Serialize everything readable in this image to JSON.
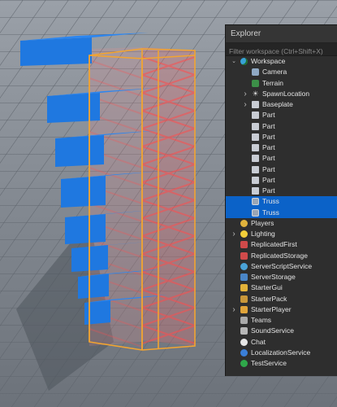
{
  "explorer": {
    "title": "Explorer",
    "filter_placeholder": "Filter workspace (Ctrl+Shift+X)",
    "items": [
      {
        "label": "Workspace",
        "icon": "workspace-icon",
        "depth": 0,
        "chevron": "expanded",
        "selected": false
      },
      {
        "label": "Camera",
        "icon": "camera-icon",
        "depth": 1,
        "chevron": "",
        "selected": false
      },
      {
        "label": "Terrain",
        "icon": "terrain-icon",
        "depth": 1,
        "chevron": "",
        "selected": false
      },
      {
        "label": "SpawnLocation",
        "icon": "spawn-icon",
        "depth": 1,
        "chevron": "collapsed",
        "selected": false
      },
      {
        "label": "Baseplate",
        "icon": "part-icon",
        "depth": 1,
        "chevron": "collapsed",
        "selected": false
      },
      {
        "label": "Part",
        "icon": "part-icon",
        "depth": 1,
        "chevron": "",
        "selected": false
      },
      {
        "label": "Part",
        "icon": "part-icon",
        "depth": 1,
        "chevron": "",
        "selected": false
      },
      {
        "label": "Part",
        "icon": "part-icon",
        "depth": 1,
        "chevron": "",
        "selected": false
      },
      {
        "label": "Part",
        "icon": "part-icon",
        "depth": 1,
        "chevron": "",
        "selected": false
      },
      {
        "label": "Part",
        "icon": "part-icon",
        "depth": 1,
        "chevron": "",
        "selected": false
      },
      {
        "label": "Part",
        "icon": "part-icon",
        "depth": 1,
        "chevron": "",
        "selected": false
      },
      {
        "label": "Part",
        "icon": "part-icon",
        "depth": 1,
        "chevron": "",
        "selected": false
      },
      {
        "label": "Part",
        "icon": "part-icon",
        "depth": 1,
        "chevron": "",
        "selected": false
      },
      {
        "label": "Truss",
        "icon": "truss-icon",
        "depth": 1,
        "chevron": "",
        "selected": true
      },
      {
        "label": "Truss",
        "icon": "truss-icon",
        "depth": 1,
        "chevron": "",
        "selected": true
      },
      {
        "label": "Players",
        "icon": "players-icon",
        "depth": 0,
        "chevron": "",
        "selected": false
      },
      {
        "label": "Lighting",
        "icon": "lighting-icon",
        "depth": 0,
        "chevron": "collapsed",
        "selected": false
      },
      {
        "label": "ReplicatedFirst",
        "icon": "replicated-first-icon",
        "depth": 0,
        "chevron": "",
        "selected": false
      },
      {
        "label": "ReplicatedStorage",
        "icon": "replicated-storage-icon",
        "depth": 0,
        "chevron": "",
        "selected": false
      },
      {
        "label": "ServerScriptService",
        "icon": "server-script-service-icon",
        "depth": 0,
        "chevron": "",
        "selected": false
      },
      {
        "label": "ServerStorage",
        "icon": "server-storage-icon",
        "depth": 0,
        "chevron": "",
        "selected": false
      },
      {
        "label": "StarterGui",
        "icon": "starter-gui-icon",
        "depth": 0,
        "chevron": "",
        "selected": false
      },
      {
        "label": "StarterPack",
        "icon": "starter-pack-icon",
        "depth": 0,
        "chevron": "",
        "selected": false
      },
      {
        "label": "StarterPlayer",
        "icon": "starter-player-icon",
        "depth": 0,
        "chevron": "collapsed",
        "selected": false
      },
      {
        "label": "Teams",
        "icon": "teams-icon",
        "depth": 0,
        "chevron": "",
        "selected": false
      },
      {
        "label": "SoundService",
        "icon": "sound-service-icon",
        "depth": 0,
        "chevron": "",
        "selected": false
      },
      {
        "label": "Chat",
        "icon": "chat-icon",
        "depth": 0,
        "chevron": "",
        "selected": false
      },
      {
        "label": "LocalizationService",
        "icon": "localization-service-icon",
        "depth": 0,
        "chevron": "",
        "selected": false
      },
      {
        "label": "TestService",
        "icon": "test-service-icon",
        "depth": 0,
        "chevron": "",
        "selected": false
      }
    ]
  },
  "colors": {
    "selection": "#0b62c8",
    "panel_bg": "#2e2e2e",
    "part_blue": "#1f78e0",
    "truss_highlight": "#f2a431",
    "truss_members": "#ff5a5a"
  }
}
